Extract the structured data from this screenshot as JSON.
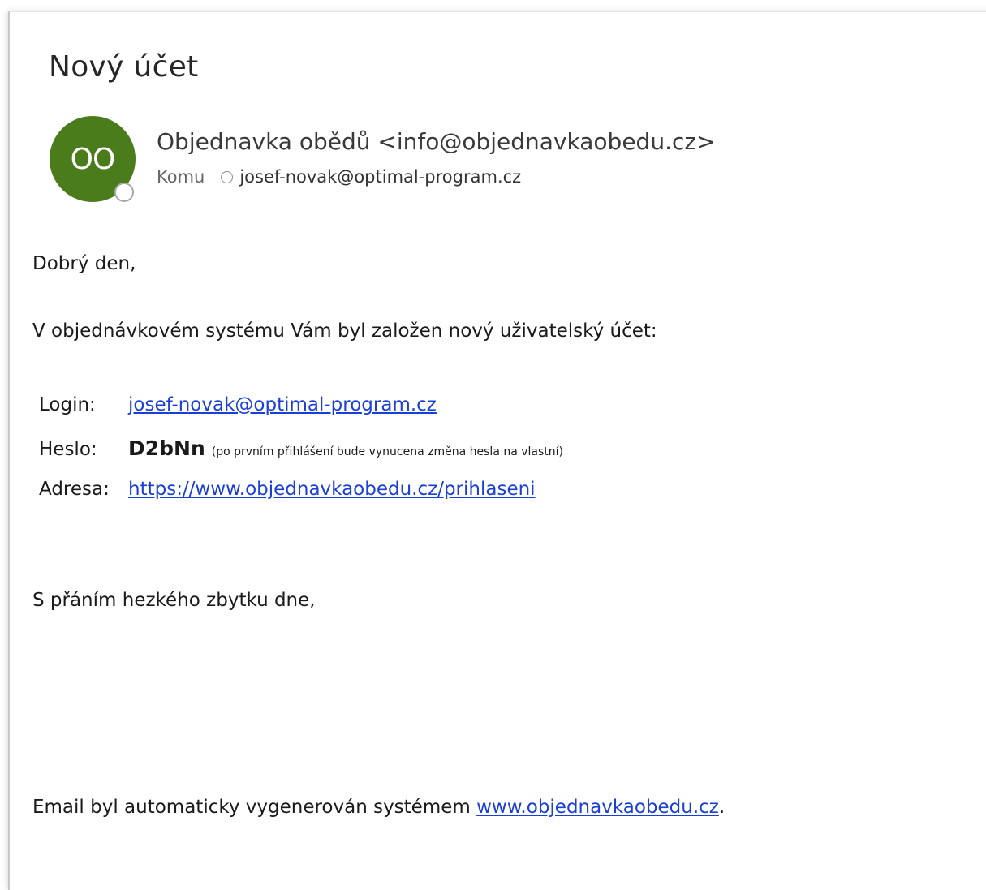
{
  "message": {
    "subject": "Nový účet",
    "sender": {
      "initials": "OO",
      "display": "Objednavka obědů <info@objednavkaobedu.cz>",
      "avatar_color": "#4a7c1c"
    },
    "to": {
      "label": "Komu",
      "email": "josef-novak@optimal-program.cz"
    }
  },
  "body": {
    "greeting": "Dobrý den,",
    "intro": "V objednávkovém systému Vám byl založen nový uživatelský účet:",
    "login_label": "Login:",
    "login_value": "josef-novak@optimal-program.cz",
    "password_label": "Heslo:",
    "password_value": "D2bNn",
    "password_note": "(po prvním přihlášení bude vynucena změna hesla na vlastní)",
    "address_label": "Adresa:",
    "address_value": "https://www.objednavkaobedu.cz/prihlaseni",
    "closing": "S přáním hezkého zbytku dne,",
    "footer_text": "Email byl automaticky vygenerován systémem",
    "footer_link": "www.objednavkaobedu.cz",
    "footer_end": "."
  }
}
